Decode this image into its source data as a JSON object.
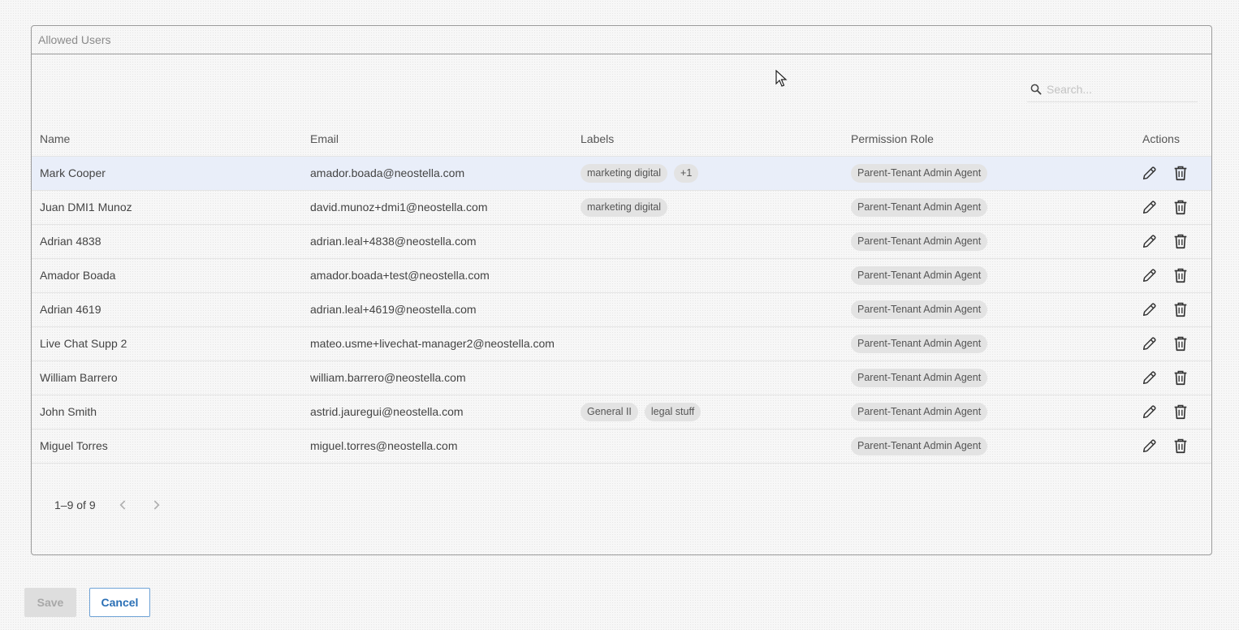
{
  "panel": {
    "title": "Allowed Users"
  },
  "search": {
    "placeholder": "Search..."
  },
  "table": {
    "headers": {
      "name": "Name",
      "email": "Email",
      "labels": "Labels",
      "role": "Permission Role",
      "actions": "Actions"
    },
    "rows": [
      {
        "name": "Mark Cooper",
        "email": "amador.boada@neostella.com",
        "labels": [
          "marketing digital",
          "+1"
        ],
        "role": "Parent-Tenant Admin Agent"
      },
      {
        "name": "Juan DMI1 Munoz",
        "email": "david.munoz+dmi1@neostella.com",
        "labels": [
          "marketing digital"
        ],
        "role": "Parent-Tenant Admin Agent"
      },
      {
        "name": "Adrian 4838",
        "email": "adrian.leal+4838@neostella.com",
        "labels": [],
        "role": "Parent-Tenant Admin Agent"
      },
      {
        "name": "Amador Boada",
        "email": "amador.boada+test@neostella.com",
        "labels": [],
        "role": "Parent-Tenant Admin Agent"
      },
      {
        "name": "Adrian 4619",
        "email": "adrian.leal+4619@neostella.com",
        "labels": [],
        "role": "Parent-Tenant Admin Agent"
      },
      {
        "name": "Live Chat Supp 2",
        "email": "mateo.usme+livechat-manager2@neostella.com",
        "labels": [],
        "role": "Parent-Tenant Admin Agent"
      },
      {
        "name": "William Barrero",
        "email": "william.barrero@neostella.com",
        "labels": [],
        "role": "Parent-Tenant Admin Agent"
      },
      {
        "name": "John Smith",
        "email": "astrid.jauregui@neostella.com",
        "labels": [
          "General II",
          "legal stuff"
        ],
        "role": "Parent-Tenant Admin Agent"
      },
      {
        "name": "Miguel Torres",
        "email": "miguel.torres@neostella.com",
        "labels": [],
        "role": "Parent-Tenant Admin Agent"
      }
    ]
  },
  "pagination": {
    "range": "1–9 of 9"
  },
  "buttons": {
    "save": "Save",
    "cancel": "Cancel"
  },
  "icons": {
    "search": "search-icon",
    "edit": "pencil-icon",
    "delete": "trash-icon",
    "prev": "chevron-left-icon",
    "next": "chevron-right-icon"
  },
  "colors": {
    "selected_row": "#e9eef9",
    "cancel_text": "#2a6fb5",
    "chip_bg": "#e3e3e3"
  }
}
